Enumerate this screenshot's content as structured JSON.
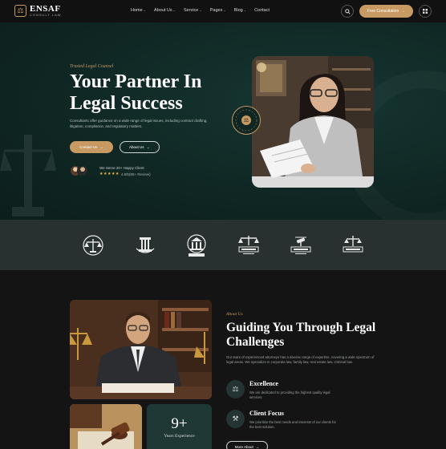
{
  "brand": {
    "name": "ENSAF",
    "tagline": "CONSULT LAW"
  },
  "nav": {
    "items": [
      {
        "label": "Home",
        "dropdown": true
      },
      {
        "label": "About Us",
        "dropdown": true
      },
      {
        "label": "Service",
        "dropdown": true
      },
      {
        "label": "Pages",
        "dropdown": true
      },
      {
        "label": "Blog",
        "dropdown": true
      },
      {
        "label": "Contact",
        "dropdown": false
      }
    ],
    "search_icon": "search-icon",
    "cta_label": "Free Consultation",
    "menu_icon": "grid-menu-icon"
  },
  "hero": {
    "eyebrow": "Trusted Legal Counsel",
    "title": "Your Partner In Legal Success",
    "description": "Consultants offer guidance on a wide range of legal issues, including contract drafting, litigation, compliance, and regulatory matters.",
    "primary_button": "Contact Us",
    "secondary_button": "About Us",
    "clients_text": "We Serve 20+ Happy Client",
    "stars": "★★★★★",
    "rating_text": "4.8/5(85+ Review)",
    "badge_text": "BEST LAWYER CONSULT"
  },
  "partners": [
    {
      "name": "justice-scale-logo"
    },
    {
      "name": "pillar-logo"
    },
    {
      "name": "court-building-logo",
      "caption": "JUSTICE & TRUST"
    },
    {
      "name": "law-office-logo-1",
      "caption": "LAW OFFICE"
    },
    {
      "name": "law-office-logo-2",
      "caption": "LAW OFFICE"
    },
    {
      "name": "law-office-logo-3",
      "caption": "LAW OFFICE"
    }
  ],
  "about": {
    "eyebrow": "About Us",
    "title": "Guiding You Through Legal Challenges",
    "description": "Our team of experienced attorneys has a diverse range of expertise, covering a wide spectrum of legal areas. We specialize in corporate law, family law, real estate law, criminal law.",
    "features": [
      {
        "title": "Excellence",
        "description": "We are dedicated to providing the highest quality legal services.",
        "icon": "scale-icon"
      },
      {
        "title": "Client Focus",
        "description": "We prioritize the best needs and interests of our clients for the best solution.",
        "icon": "handshake-icon"
      }
    ],
    "more_button": "More About",
    "years_number": "9+",
    "years_label": "Years Experience"
  },
  "colors": {
    "accent": "#c79a63",
    "hero_bg": "#0f2623",
    "band_bg": "#283130",
    "page_bg": "#141414"
  }
}
